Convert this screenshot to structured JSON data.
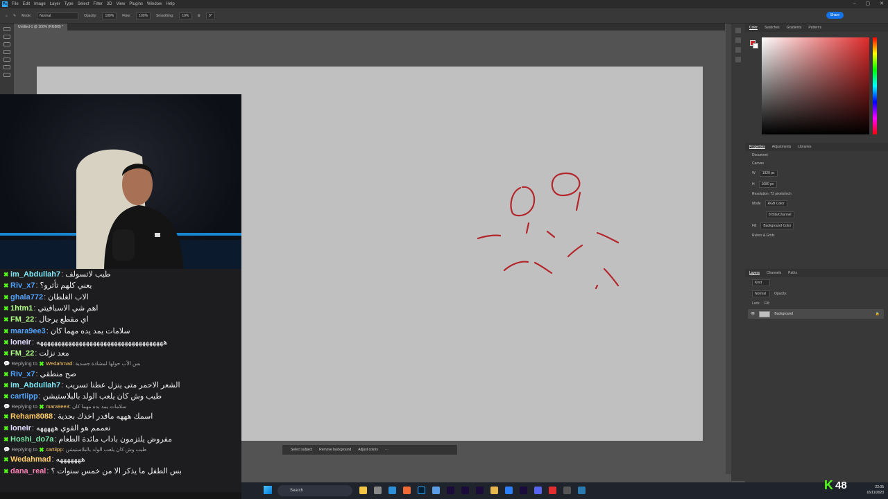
{
  "app": {
    "menu": [
      "File",
      "Edit",
      "Image",
      "Layer",
      "Type",
      "Select",
      "Filter",
      "3D",
      "View",
      "Plugins",
      "Window",
      "Help"
    ],
    "doc_tab": "Untitled-1 @ 100% (RGB/8) *",
    "options": {
      "mode_label": "Mode:",
      "mode": "Normal",
      "opacity_label": "Opacity:",
      "opacity": "100%",
      "flow_label": "Flow:",
      "flow": "100%",
      "smoothing_label": "Smoothing:",
      "smoothing": "10%",
      "angle": "0°"
    },
    "share": "Share"
  },
  "panels": {
    "color_tabs": [
      "Color",
      "Swatches",
      "Gradients",
      "Patterns"
    ],
    "prop_tabs": [
      "Properties",
      "Adjustments",
      "Libraries"
    ],
    "document": "Document",
    "canvas_section": "Canvas",
    "w": "1920 px",
    "h": "1080 px",
    "resolution": "Resolution: 72 pixels/inch",
    "mode_label": "Mode",
    "mode": "RGB Color",
    "bits": "8 Bits/Channel",
    "fill": "Fill",
    "fill_value": "Background Color",
    "rulers": "Rulers & Grids",
    "layer_tabs": [
      "Layers",
      "Channels",
      "Paths"
    ],
    "layer_kind": "Kind",
    "layer_mode": "Normal",
    "layer_opacity": "Opacity:",
    "lock": "Lock:",
    "fill2": "Fill:",
    "layer_name": "Background"
  },
  "context_bar": [
    "Select subject",
    "Remove background",
    "Adjust colors"
  ],
  "chat": [
    {
      "type": "msg",
      "user": "im_Abdullah7",
      "color": "#7ee8f5",
      "text": "طيب لاتسولف"
    },
    {
      "type": "msg",
      "user": "Riv_x7",
      "color": "#4fa3ff",
      "text": "يعني كلهم تأثرو؟"
    },
    {
      "type": "msg",
      "user": "ghala772",
      "color": "#4fa3ff",
      "text": "الاب الغلطان"
    },
    {
      "type": "msg",
      "user": "1htm1",
      "color": "#b0ff86",
      "text": "اهم شي الاسباقيتي"
    },
    {
      "type": "msg",
      "user": "FM_22",
      "color": "#b0ff86",
      "text": "اي مقطع يرجال"
    },
    {
      "type": "msg",
      "user": "mara9ee3",
      "color": "#4fa3ff",
      "text": "سلامات يمد يده مهما كان"
    },
    {
      "type": "msg",
      "user": "loneir",
      "color": "#e0d8ff",
      "text": "ههههههههههههههههههههههههههههههههههههه"
    },
    {
      "type": "msg",
      "user": "FM_22",
      "color": "#b0ff86",
      "text": "معد نزلت"
    },
    {
      "type": "reply",
      "label": "Replying to",
      "user": "Wedahmad",
      "text": "بس الأب حولها لمشادة جسدية"
    },
    {
      "type": "msg",
      "user": "Riv_x7",
      "color": "#4fa3ff",
      "text": "صح منطقي"
    },
    {
      "type": "msg",
      "user": "im_Abdullah7",
      "color": "#7ee8f5",
      "text": "الشعر الاحمر متى ينزل عطنا تسريب"
    },
    {
      "type": "msg",
      "user": "cartiipp",
      "color": "#4fa3ff",
      "text": "طيب وش كان يلعب الولد بالبلاستيشن"
    },
    {
      "type": "reply",
      "label": "Replying to",
      "user": "mara9ee3",
      "text": "سلامات يمد يده مهما كان"
    },
    {
      "type": "msg",
      "user": "Reham8088",
      "color": "#ffcc66",
      "text": "اسمك هههه ماقدر اخذك بجدية"
    },
    {
      "type": "msg",
      "user": "loneir",
      "color": "#e0d8ff",
      "text": "نعممم هو القوي هههههه"
    },
    {
      "type": "msg",
      "user": "Hoshi_do7a",
      "color": "#7ee8a8",
      "text": "مفروض يلتزمون باداب مائدة الطعام"
    },
    {
      "type": "reply",
      "label": "Replying to",
      "user": "cartiipp",
      "text": "طيب وش كان يلعب الولد بالبلاستيشن"
    },
    {
      "type": "msg",
      "user": "Wedahmad",
      "color": "#ffcc66",
      "text": "هههههههه"
    },
    {
      "type": "msg",
      "user": "dana_real",
      "color": "#ff7eb6",
      "text": "بس الطفل ما يذكر الا من خمس سنوات ؟"
    }
  ],
  "taskbar": {
    "search": "Search",
    "time": "22:05",
    "date": "16/11/2023"
  },
  "kick": {
    "count": "48"
  }
}
